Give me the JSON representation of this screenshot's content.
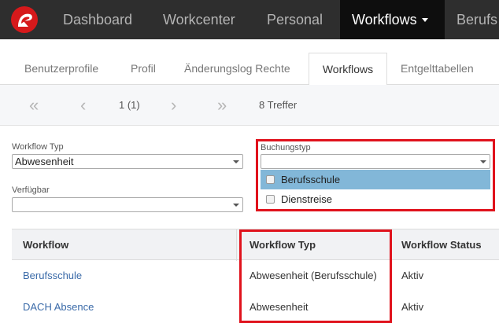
{
  "navbar": {
    "logo": "company-logo",
    "items": [
      {
        "label": "Dashboard"
      },
      {
        "label": "Workcenter"
      },
      {
        "label": "Personal"
      },
      {
        "label": "Workflows"
      },
      {
        "label": "Berufs"
      }
    ],
    "active": "Workflows"
  },
  "tabs": {
    "items": [
      {
        "label": "Benutzerprofile"
      },
      {
        "label": "Profil"
      },
      {
        "label": "Änderungslog Rechte"
      },
      {
        "label": "Workflows"
      },
      {
        "label": "Entgelttabellen"
      }
    ],
    "active": "Workflows"
  },
  "pager": {
    "first": "«",
    "prev": "‹",
    "page": "1 (1)",
    "next": "›",
    "last": "»",
    "hits": "8 Treffer"
  },
  "filters": {
    "workflow_typ": {
      "label": "Workflow Typ",
      "value": "Abwesenheit"
    },
    "verfuegbar": {
      "label": "Verfügbar",
      "value": ""
    },
    "buchungstyp": {
      "label": "Buchungstyp",
      "value": "",
      "options": [
        {
          "label": "Berufsschule",
          "highlighted": true
        },
        {
          "label": "Dienstreise",
          "highlighted": false
        }
      ]
    }
  },
  "table": {
    "headers": [
      "Workflow",
      "Workflow Typ",
      "Workflow Status"
    ],
    "rows": [
      {
        "workflow": "Berufsschule",
        "typ": "Abwesenheit (Berufsschule)",
        "status": "Aktiv"
      },
      {
        "workflow": "DACH Absence",
        "typ": "Abwesenheit",
        "status": "Aktiv"
      }
    ]
  },
  "colors": {
    "navbar": "#2e2e2e",
    "navbar_active": "#0e0e0e",
    "highlight_box": "#e0121c",
    "option_highlight": "#82b7d8",
    "link": "#3a6aa8"
  }
}
